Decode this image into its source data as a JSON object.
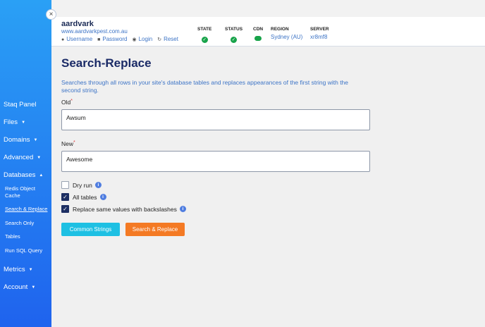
{
  "sidebar": {
    "close_icon": "×",
    "nav": [
      {
        "label": "Staq Panel"
      },
      {
        "label": "Files",
        "caret": "▼"
      },
      {
        "label": "Domains",
        "caret": "▼"
      },
      {
        "label": "Advanced",
        "caret": "▼"
      },
      {
        "label": "Databases",
        "caret": "▲"
      }
    ],
    "sub": [
      "Redis Object Cache",
      "Search & Replace",
      "Search Only",
      "Tables",
      "Run SQL Query"
    ],
    "nav_bottom": [
      {
        "label": "Metrics",
        "caret": "▼"
      },
      {
        "label": "Account",
        "caret": "▼"
      }
    ]
  },
  "header": {
    "site_name": "aardvark",
    "site_url": "www.aardvarkpest.com.au",
    "links": [
      "Username",
      "Password",
      "Login",
      "Reset"
    ],
    "link_icons": [
      "user-icon",
      "lock-icon",
      "wordpress-icon",
      "reset-icon"
    ],
    "state": {
      "label": "STATE",
      "icon": "check-circle-icon"
    },
    "status": {
      "label": "STATUS",
      "icon": "check-circle-icon"
    },
    "cdn": {
      "label": "CDN",
      "icon": "cloud-icon"
    },
    "region": {
      "label": "REGION",
      "value": "Sydney (AU)"
    },
    "server": {
      "label": "SERVER",
      "value": "xr8mf8"
    }
  },
  "main": {
    "title": "Search-Replace",
    "description": "Searches through all rows in your site's database tables and replaces appearances of the first string with the second string.",
    "old_label": "Old",
    "old_value": "Awsum",
    "new_label": "New",
    "new_value": "Awesome",
    "required_mark": "*",
    "options": [
      {
        "label": "Dry run",
        "checked": false
      },
      {
        "label": "All tables",
        "checked": true
      },
      {
        "label": "Replace same values with backslashes",
        "checked": true
      }
    ],
    "info_glyph": "i",
    "buttons": {
      "common": "Common Strings",
      "search_replace": "Search & Replace"
    }
  },
  "colors": {
    "accent": "#1f63ee",
    "orange": "#f47a24",
    "cyan": "#1ec0e3",
    "ok": "#18a34a"
  }
}
